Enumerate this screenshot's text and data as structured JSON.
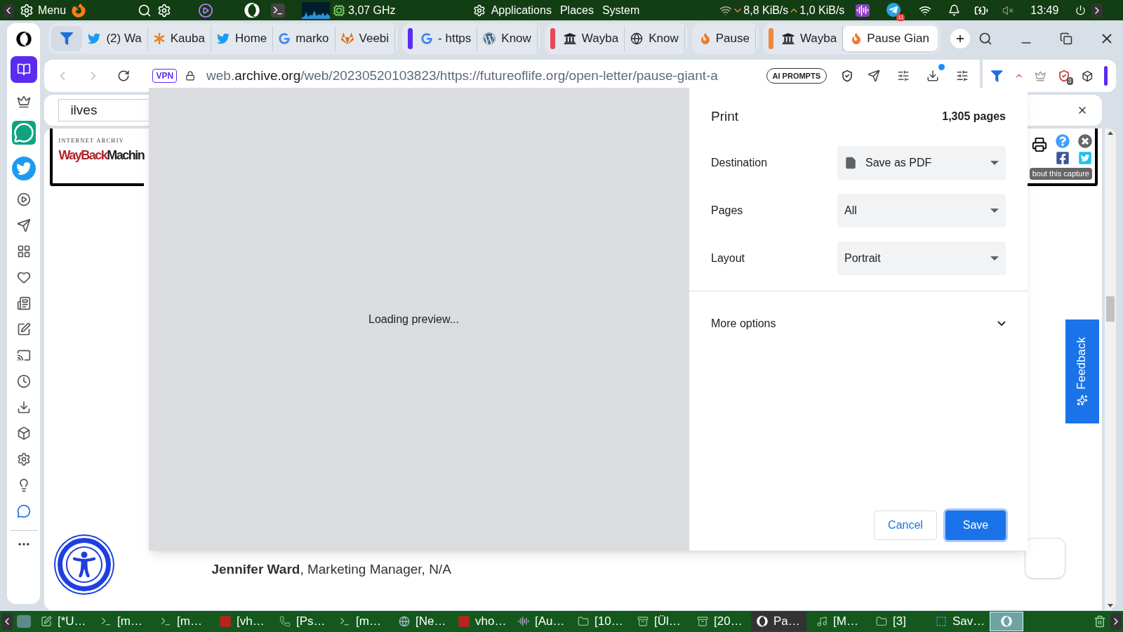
{
  "top_panel": {
    "menu": "Menu",
    "cpu_freq": "3,07 GHz",
    "menus": [
      "Applications",
      "Places",
      "System"
    ],
    "net_down": "8,8 KiB/s",
    "net_up": "1,0 KiB/s",
    "telegram_badge": "11",
    "clock": "13:49"
  },
  "tab_groups": [
    {
      "tabs": [
        {
          "kind": "pinned",
          "selected": false
        },
        {
          "title": "(2) Wa",
          "kind": "twitter",
          "selected": false
        },
        {
          "title": "Kauba",
          "kind": "asterisk",
          "selected": false
        },
        {
          "title": "Home",
          "kind": "twitter",
          "selected": false
        },
        {
          "title": "marko",
          "kind": "google",
          "selected": false
        },
        {
          "title": "Veebi",
          "kind": "fox",
          "selected": false
        }
      ]
    },
    {
      "color": "#5b2cf0",
      "tabs": [
        {
          "title": "- https",
          "kind": "google",
          "selected": false
        },
        {
          "title": "Know",
          "kind": "wordpress",
          "selected": false
        }
      ]
    },
    {
      "color": "#e8465a",
      "tabs": [
        {
          "title": "Wayba",
          "kind": "archive",
          "selected": false
        },
        {
          "title": "Know",
          "kind": "globe",
          "selected": false
        }
      ]
    },
    {
      "tabs": [
        {
          "title": "Pause",
          "kind": "flame",
          "selected": false
        }
      ]
    },
    {
      "color": "#f0883e",
      "tabs": [
        {
          "title": "Wayba",
          "kind": "archive",
          "selected": false
        },
        {
          "title": "Pause Gian",
          "kind": "flame",
          "selected": true
        }
      ]
    }
  ],
  "address_bar": {
    "vpn": "VPN",
    "url_prefix": "web.",
    "url_host": "archive.org",
    "url_path": "/web/20230520103823/https://futureoflife.org/open-letter/pause-giant-a",
    "ai_button": "AI PROMPTS",
    "download_badge": true,
    "extension_badge": "3"
  },
  "find_bar": {
    "value": "ilves"
  },
  "page": {
    "wayback": {
      "top": "INTERNET ARCHIV",
      "logo_red": "WayBack",
      "logo_dark": "Machin",
      "capture": "bout this capture"
    },
    "signature": "**Jennifer Ward**, Marketing Manager, N/A",
    "feedback": "Feedback"
  },
  "print_dialog": {
    "preview": "Loading preview...",
    "title": "Print",
    "page_count": "1,305 pages",
    "settings": [
      {
        "label": "Destination",
        "value": "Save as PDF",
        "kind": "destination"
      },
      {
        "label": "Pages",
        "value": "All",
        "kind": "select"
      },
      {
        "label": "Layout",
        "value": "Portrait",
        "kind": "select"
      }
    ],
    "more_options": {
      "label": "More options",
      "expanded": false
    },
    "buttons": [
      {
        "label": "Cancel",
        "primary": false
      },
      {
        "label": "Save",
        "primary": true
      }
    ]
  },
  "taskbar": {
    "items": [
      {
        "title": "[*U…",
        "kind": "editor",
        "selected": false
      },
      {
        "title": "[m…",
        "kind": "terminal",
        "selected": false
      },
      {
        "title": "[m…",
        "kind": "terminal",
        "selected": false
      },
      {
        "title": "[vh…",
        "kind": "filezilla",
        "selected": false
      },
      {
        "title": "[Ps…",
        "kind": "phone",
        "selected": false
      },
      {
        "title": "[m…",
        "kind": "terminal",
        "selected": false
      },
      {
        "title": "[Ne…",
        "kind": "globe",
        "selected": false
      },
      {
        "title": "vho…",
        "kind": "filezilla",
        "selected": false
      },
      {
        "title": "[Au…",
        "kind": "audio",
        "selected": false
      },
      {
        "title": "[10…",
        "kind": "folder",
        "selected": false
      },
      {
        "title": "[Ül…",
        "kind": "archive",
        "selected": false
      },
      {
        "title": "[20…",
        "kind": "archive",
        "selected": false
      },
      {
        "title": "Pa…",
        "kind": "opera",
        "selected": true
      },
      {
        "title": "[M…",
        "kind": "music",
        "selected": false
      },
      {
        "title": "[3]",
        "kind": "folder",
        "selected": false
      },
      {
        "title": "Sav…",
        "kind": "screenshot",
        "selected": false
      }
    ]
  }
}
